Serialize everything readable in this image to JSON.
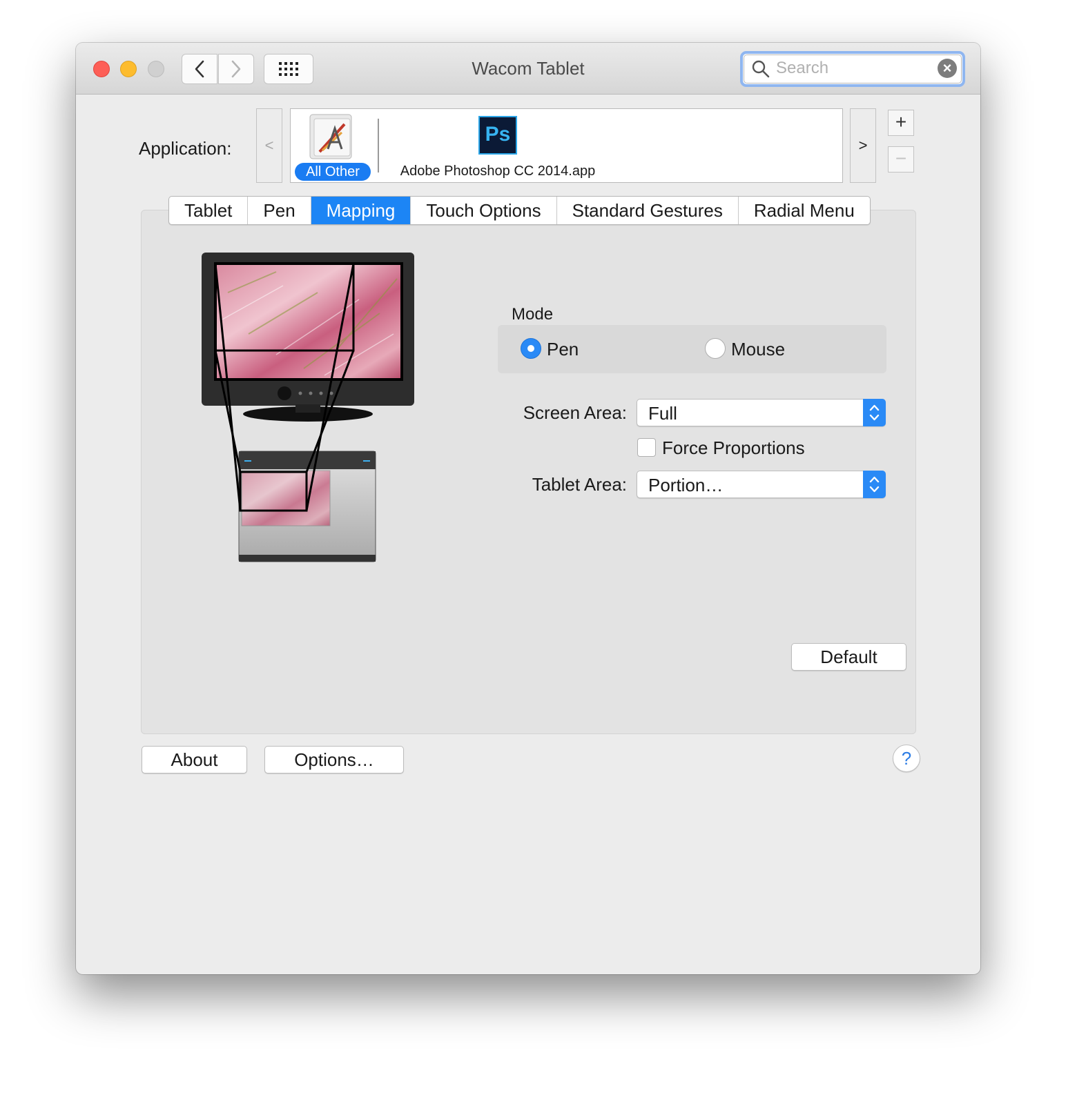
{
  "window": {
    "title": "Wacom Tablet"
  },
  "toolbar": {
    "search_placeholder": "Search"
  },
  "application": {
    "label": "Application:",
    "prev_arrow": "<",
    "next_arrow": ">",
    "items": [
      {
        "label": "All Other",
        "selected": true,
        "icon": "all-other-apps-icon"
      },
      {
        "label": "Adobe Photoshop CC 2014.app",
        "selected": false,
        "icon": "photoshop-icon",
        "icon_text": "Ps"
      }
    ],
    "add_label": "+",
    "remove_label": "−"
  },
  "tabs": [
    {
      "label": "Tablet",
      "active": false
    },
    {
      "label": "Pen",
      "active": false
    },
    {
      "label": "Mapping",
      "active": true
    },
    {
      "label": "Touch Options",
      "active": false
    },
    {
      "label": "Standard Gestures",
      "active": false
    },
    {
      "label": "Radial Menu",
      "active": false
    }
  ],
  "mapping": {
    "mode_label": "Mode",
    "mode_options": [
      "Pen",
      "Mouse"
    ],
    "mode_selected": "Pen",
    "screen_area_label": "Screen Area:",
    "screen_area_value": "Full",
    "force_proportions_label": "Force Proportions",
    "force_proportions_checked": false,
    "tablet_area_label": "Tablet Area:",
    "tablet_area_value": "Portion…",
    "default_button": "Default"
  },
  "footer": {
    "about_button": "About",
    "options_button": "Options…",
    "help_label": "?"
  },
  "colors": {
    "accent": "#1c85f5",
    "close": "#fd5f57",
    "minimize": "#fdbc2e",
    "zoom_disabled": "#d0d0d0"
  }
}
